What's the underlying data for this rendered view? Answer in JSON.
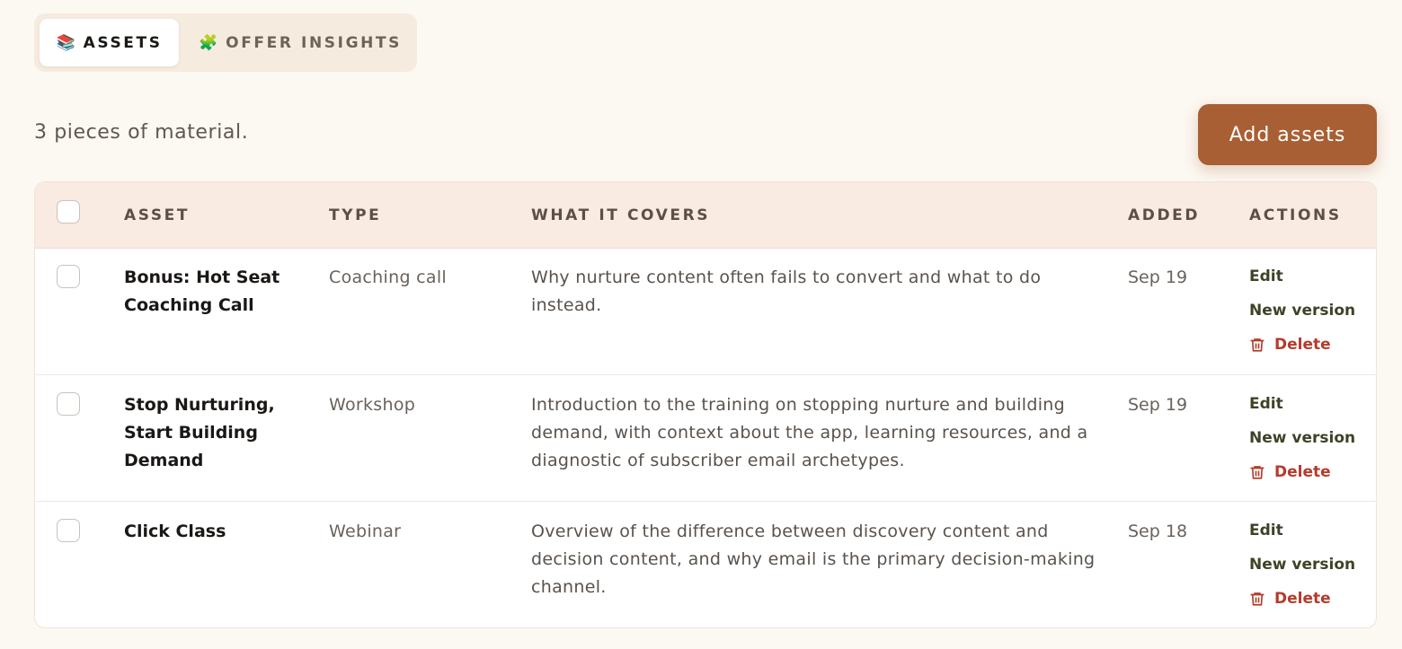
{
  "tabs": [
    {
      "emoji": "📚",
      "label": "ASSETS",
      "active": true
    },
    {
      "emoji": "🧩",
      "label": "OFFER INSIGHTS",
      "active": false
    }
  ],
  "summary": "3 pieces of material.",
  "add_button": "Add assets",
  "colors": {
    "accent": "#a85f33",
    "background": "#fcf8f2",
    "header_bg": "#f9eae2",
    "action_text": "#3e4326",
    "delete_text": "#b53b2c"
  },
  "table": {
    "headers": {
      "asset": "ASSET",
      "type": "TYPE",
      "covers": "WHAT IT COVERS",
      "added": "ADDED",
      "actions": "ACTIONS"
    },
    "action_labels": {
      "edit": "Edit",
      "new_version": "New version",
      "delete": "Delete",
      "delete_icon": "trash-icon"
    },
    "rows": [
      {
        "asset": "Bonus: Hot Seat Coaching Call",
        "type": "Coaching call",
        "covers": "Why nurture content often fails to convert and what to do instead.",
        "added": "Sep 19"
      },
      {
        "asset": "Stop Nurturing, Start Building Demand",
        "type": "Workshop",
        "covers": "Introduction to the training on stopping nurture and building demand, with context about the app, learning resources, and a diagnostic of subscriber email archetypes.",
        "added": "Sep 19"
      },
      {
        "asset": "Click Class",
        "type": "Webinar",
        "covers": "Overview of the difference between discovery content and decision content, and why email is the primary decision-making channel.",
        "added": "Sep 18"
      }
    ]
  }
}
